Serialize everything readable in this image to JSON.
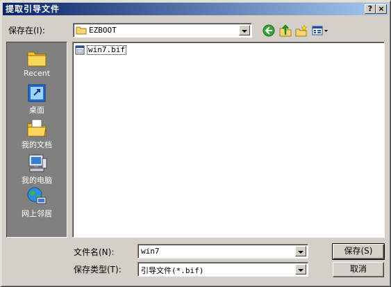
{
  "window": {
    "title": "提取引导文件",
    "help_glyph": "?",
    "close_glyph": "×"
  },
  "save_in": {
    "label": "保存在(I):",
    "value": "EZBOOT"
  },
  "toolbar": {
    "icons": [
      "back-icon",
      "up-folder-icon",
      "new-folder-icon",
      "view-menu-icon"
    ]
  },
  "places": [
    {
      "label": "Recent",
      "icon": "recent-icon"
    },
    {
      "label": "桌面",
      "icon": "desktop-icon"
    },
    {
      "label": "我的文档",
      "icon": "my-documents-icon"
    },
    {
      "label": "我的电脑",
      "icon": "my-computer-icon"
    },
    {
      "label": "网上邻居",
      "icon": "network-icon"
    }
  ],
  "files": [
    {
      "name": "win7.bif"
    }
  ],
  "filename": {
    "label": "文件名(N):",
    "value": "win7"
  },
  "filetype": {
    "label": "保存类型(T):",
    "value": "引导文件(*.bif)"
  },
  "buttons": {
    "save": "保存(S)",
    "cancel": "取消"
  },
  "colors": {
    "title_start": "#0a246a",
    "title_end": "#a6caf0",
    "face": "#d4d0c8",
    "places_bg": "#808080"
  }
}
